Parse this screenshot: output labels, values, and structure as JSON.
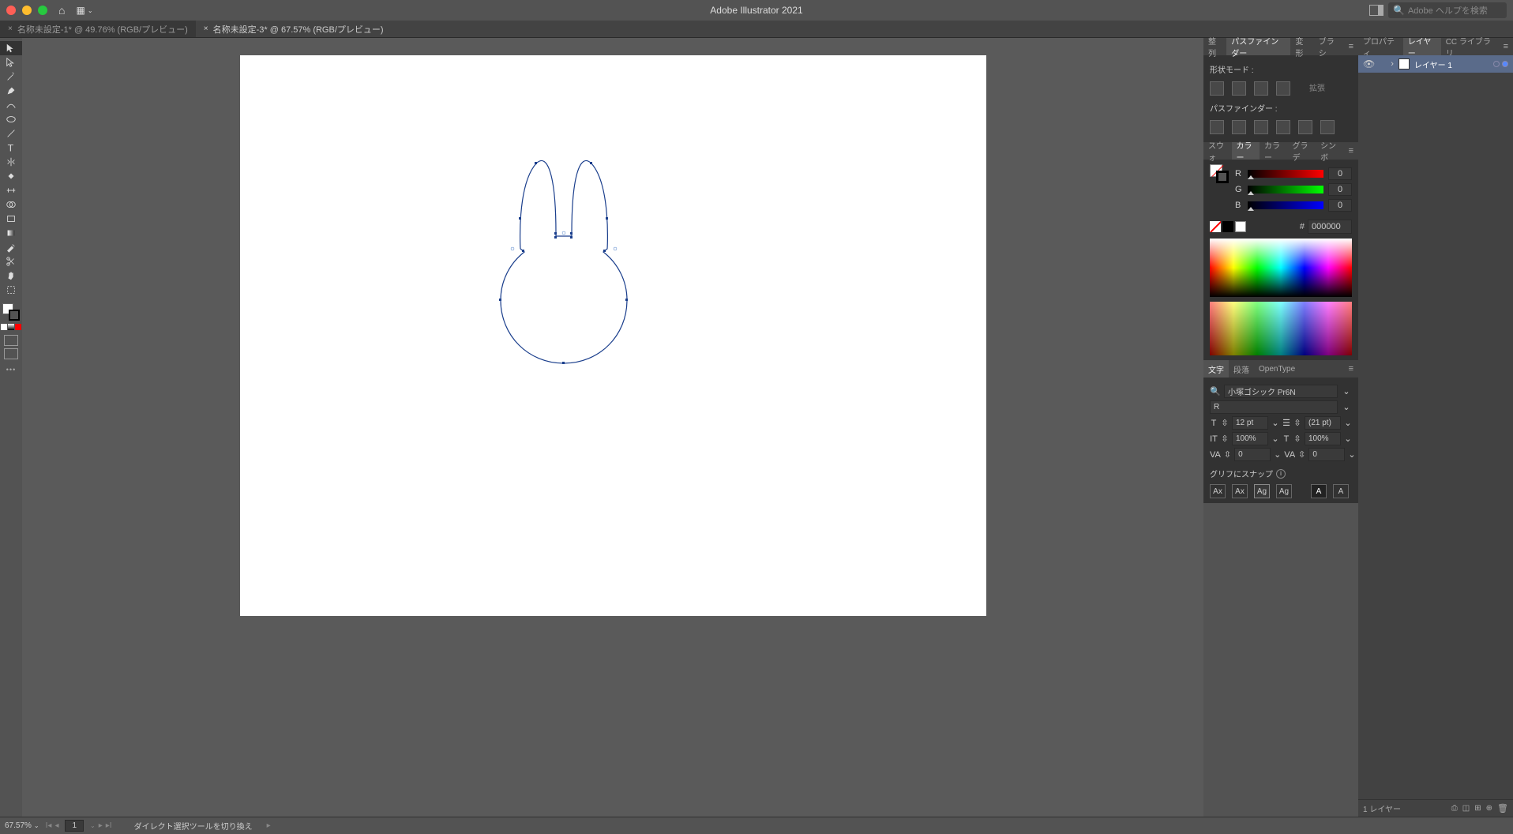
{
  "titlebar": {
    "app_title": "Adobe Illustrator 2021",
    "search_placeholder": "Adobe ヘルプを検索"
  },
  "tabs": [
    {
      "label": "名称未設定-1* @ 49.76% (RGB/プレビュー)",
      "active": false
    },
    {
      "label": "名称未設定-3* @ 67.57% (RGB/プレビュー)",
      "active": true
    }
  ],
  "panels": {
    "row1_tabs": [
      "整列",
      "パスファインダー",
      "変形",
      "ブラシ"
    ],
    "row1_active": "パスファインダー",
    "shape_mode_label": "形状モード :",
    "pathfinder_label": "パスファインダー :",
    "expand_label": "拡張",
    "row2_tabs": [
      "スウォ",
      "カラー",
      "カラー",
      "グラデ",
      "シンボ"
    ],
    "row2_active": "カラー",
    "rgb": {
      "r": "0",
      "g": "0",
      "b": "0"
    },
    "hex_prefix": "#",
    "hex": "000000",
    "row3_tabs": [
      "文字",
      "段落",
      "OpenType"
    ],
    "row3_active": "文字",
    "font_name": "小塚ゴシック Pr6N",
    "font_style": "R",
    "font_size": "12 pt",
    "leading": "(21 pt)",
    "vscale": "100%",
    "hscale": "100%",
    "kerning": "0",
    "tracking": "0",
    "snap_label": "グリフにスナップ",
    "layer_tabs": [
      "プロパティ",
      "レイヤー",
      "CC ライブラリ"
    ],
    "layer_tabs_active": "レイヤー",
    "layer_name": "レイヤー 1",
    "layer_count_label": "1 レイヤー"
  },
  "statusbar": {
    "zoom": "67.57%",
    "page": "1",
    "tool_hint": "ダイレクト選択ツールを切り換え"
  }
}
